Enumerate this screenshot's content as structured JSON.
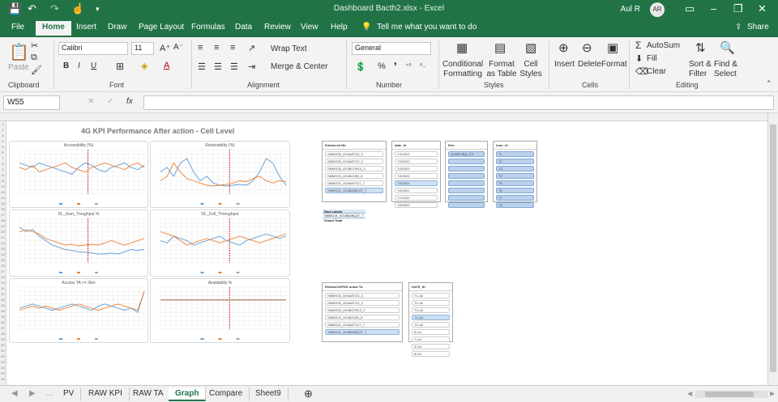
{
  "window": {
    "title": "Dashboard Bacth2.xlsx - Excel",
    "user": "Aul R",
    "avatar_initials": "AR"
  },
  "menu": [
    "File",
    "Home",
    "Insert",
    "Draw",
    "Page Layout",
    "Formulas",
    "Data",
    "Review",
    "View",
    "Help"
  ],
  "tell_me": "Tell me what you want to do",
  "share": "Share",
  "ribbon": {
    "clipboard": {
      "paste": "Paste",
      "label": "Clipboard"
    },
    "font": {
      "name": "Calibri",
      "size": "11",
      "label": "Font"
    },
    "alignment": {
      "wrap": "Wrap Text",
      "merge": "Merge & Center",
      "label": "Alignment"
    },
    "number": {
      "format": "General",
      "label": "Number"
    },
    "styles": {
      "conditional": "Conditional Formatting",
      "format_table": "Format as Table",
      "cell_styles": "Cell Styles",
      "label": "Styles"
    },
    "cells": {
      "insert": "Insert",
      "delete": "Delete",
      "format": "Format",
      "label": "Cells"
    },
    "editing": {
      "autosum": "AutoSum",
      "fill": "Fill",
      "clear": "Clear",
      "sort": "Sort & Filter",
      "find": "Find & Select",
      "label": "Editing"
    }
  },
  "namebox": "W55",
  "dashboard_title": "4G KPI Performance After action - Cell Level",
  "charts": [
    {
      "title": "Accessibility (%)"
    },
    {
      "title": "Retainability (%)"
    },
    {
      "title": "DL_User_Troughput %"
    },
    {
      "title": "DL_Cell_Throughput"
    },
    {
      "title": "Access TA <= 2km"
    },
    {
      "title": "Availability %"
    }
  ],
  "slicers": [
    {
      "header": "Enhanced Nb",
      "items": [
        "SMMG05_4G4A8TG3_3",
        "SMMG05_4G4A8TG3_2",
        "SMMG05_4G4BCPB13_3",
        "SMMG15_4G4B22ZB_8",
        "SMMG21_4G4A8TG27_7",
        "SMMG21_4G4B82BQ27_7"
      ],
      "selected": [
        5
      ]
    },
    {
      "header": "date_id",
      "items": [
        "7/1/2022",
        "7/2/2022",
        "7/3/2022",
        "7/4/2022",
        "7/5/2022",
        "7/6/2022",
        "7/7/2022",
        "7/8/2022"
      ],
      "selected": [
        4
      ]
    },
    {
      "header": "Eris",
      "items": [
        "4G4B22BQ_C3",
        "",
        "",
        "",
        "",
        "",
        "",
        ""
      ],
      "selected": [
        0,
        1,
        2,
        3,
        4,
        5,
        6,
        7
      ]
    },
    {
      "header": "hour_id",
      "items": [
        "T1",
        "T2",
        "T3",
        "T4",
        "T5",
        "T6",
        "T7",
        "T8"
      ],
      "selected": [
        0,
        1,
        2,
        3,
        4,
        5,
        6,
        7
      ]
    },
    {
      "header": "EUtranCellFDD untuk TA",
      "items": [
        "SMMG05_4G4A8TG3_3",
        "SMMG05_4G4A8TG3_2",
        "SMMG05_4G4BCPB13_3",
        "SMMG15_4G4B22ZB_8",
        "SMMG21_4G4A8TG27_7",
        "SMMG21_4G4B82BQ27_7"
      ],
      "selected": [
        5
      ]
    },
    {
      "header": "DATE_ID",
      "items": [
        "T1-Jul",
        "T2-Jul",
        "T3-Jul",
        "T4-Jul",
        "T5-Jul",
        "6-Jul",
        "7-Jul",
        "3-Jul",
        "8-Jul"
      ],
      "selected": [
        3
      ]
    }
  ],
  "pivot": {
    "header": "Row Labels",
    "row": "SMMG21_4G4B82BQ27_7",
    "total": "Grand Total"
  },
  "sheets": [
    "PV",
    "RAW KPI",
    "RAW TA",
    "Graph",
    "Compare",
    "Sheet9"
  ],
  "active_sheet": "Graph",
  "colors": {
    "excel_green": "#217346",
    "blue_series": "#5b9bd5",
    "orange_series": "#ed7d31",
    "gray_series": "#a5a5a5",
    "marker_red": "#c00000"
  }
}
